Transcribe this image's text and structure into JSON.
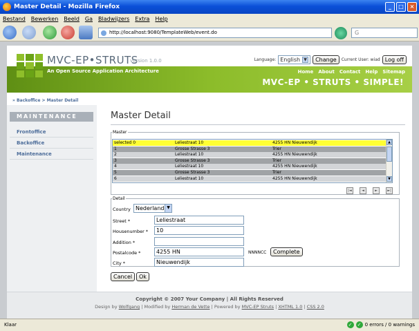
{
  "window": {
    "title": "Master Detail - Mozilla Firefox",
    "buttons": {
      "minimize": "_",
      "maximize": "□",
      "close": "×"
    }
  },
  "menu": [
    "Bestand",
    "Bewerken",
    "Beeld",
    "Ga",
    "Bladwijzers",
    "Extra",
    "Help"
  ],
  "browser": {
    "url": "http://localhost:9080/TemplateWeb/event.do",
    "search_text": "G",
    "status_left": "Klaar",
    "status_right": "0 errors / 0 warnings"
  },
  "site": {
    "title": "MVC-EP•STRUTS",
    "version": "version 1.0.0",
    "tagline": "An Open Source Application Architecture",
    "language_label": "Language:",
    "language_value": "English",
    "change_button": "Change",
    "current_user": "Current User: wiad",
    "logoff_button": "Log off",
    "nav": [
      "Home",
      "About",
      "Contact",
      "Help",
      "Sitemap"
    ],
    "slogan": "MVC-EP • STRUTS • SIMPLE!"
  },
  "breadcrumb": "» Backoffice > Master Detail",
  "sidebar": {
    "heading": "MAINTENANCE",
    "items": [
      "Frontoffice",
      "Backoffice",
      "Maintenance"
    ]
  },
  "main": {
    "title": "Master Detail",
    "master_legend": "Master",
    "rows": [
      {
        "id": "selected 0",
        "street": "Leliestraat 10",
        "postal": "4255 HN Nieuwendijk",
        "selected": true
      },
      {
        "id": "1",
        "street": "Grosse Strasse 3",
        "postal": "Trier",
        "selected": false
      },
      {
        "id": "2",
        "street": "Leliestraat 10",
        "postal": "4255 HN Nieuwendijk",
        "selected": false
      },
      {
        "id": "3",
        "street": "Grosse Strasse 3",
        "postal": "Trier",
        "selected": false
      },
      {
        "id": "4",
        "street": "Leliestraat 10",
        "postal": "4255 HN Nieuwendijk",
        "selected": false
      },
      {
        "id": "5",
        "street": "Grosse Strasse 3",
        "postal": "Trier",
        "selected": false
      },
      {
        "id": "6",
        "street": "Leliestraat 10",
        "postal": "4255 HN Nieuwendijk",
        "selected": false
      }
    ],
    "pager": {
      "first": "|◄",
      "prev": "◄",
      "next": "►",
      "last": "►|"
    },
    "detail_legend": "Detail",
    "fields": {
      "country_label": "Country",
      "country_value": "Nederland",
      "street_label": "Street *",
      "street_value": "Leliestraat",
      "housenumber_label": "Housenumber *",
      "housenumber_value": "10",
      "addition_label": "Addition *",
      "addition_value": "",
      "postalcode_label": "Postalcode *",
      "postalcode_value": "4255 HN",
      "postalcode_hint": "NNNNCC",
      "complete_button": "Complete",
      "city_label": "City *",
      "city_value": "Nieuwendijk"
    },
    "cancel_button": "Cancel",
    "ok_button": "Ok"
  },
  "footer": {
    "copyright": "Copyright © 2007 Your Company | All Rights Reserved",
    "design_prefix": "Design by",
    "designer": "Wolfgang",
    "modified_prefix": "| Modified by",
    "modifier": "Herman de Vette",
    "powered_prefix": "| Powered by",
    "powered": "MVC-EP Struts",
    "xhtml": "XHTML 1.0",
    "css": "CSS 2.0"
  },
  "colors": {
    "accent_green": "#8cbc2a",
    "selected_row": "#ffff33",
    "grid_row_dark": "#a0a3a6",
    "grid_row_light": "#d3d5d8",
    "link_blue": "#4d6d9a"
  },
  "icons": [
    "back-icon",
    "forward-icon",
    "reload-icon",
    "stop-icon",
    "home-icon",
    "go-icon",
    "google-icon",
    "status-ok-icon"
  ]
}
